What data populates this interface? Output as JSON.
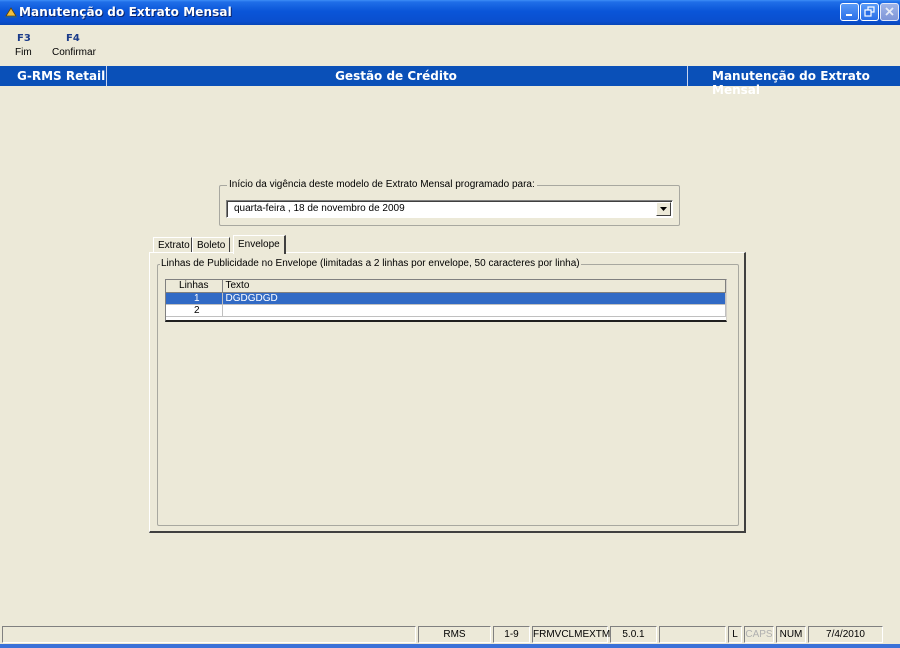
{
  "window": {
    "title": "Manutenção do Extrato Mensal"
  },
  "function_keys": [
    {
      "key": "F3",
      "label": "Fim"
    },
    {
      "key": "F4",
      "label": "Confirmar"
    }
  ],
  "header": {
    "left": "G-RMS Retail",
    "center": "Gestão de Crédito",
    "right": "Manutenção do Extrato Mensal"
  },
  "period": {
    "legend": "Início da vigência deste modelo de Extrato Mensal programado para:",
    "selected": "quarta-feira  , 18 de novembro de 2009"
  },
  "tabs": [
    "Extrato",
    "Boleto",
    "Envelope"
  ],
  "active_tab": "Envelope",
  "envelope": {
    "legend": "Linhas de Publicidade no Envelope (limitadas a 2 linhas por envelope, 50 caracteres por linha)",
    "columns": [
      "Linhas",
      "Texto"
    ],
    "rows": [
      {
        "line": "1",
        "text": "DGDGDGD",
        "selected": true
      },
      {
        "line": "2",
        "text": "",
        "selected": false
      }
    ]
  },
  "status": {
    "system": "RMS",
    "range": "1-9",
    "form": "FRMVCLMEXTM",
    "version": "5.0.1",
    "l": "L",
    "caps": "CAPS",
    "num": "NUM",
    "date": "7/4/2010"
  },
  "colors": {
    "header_band": "#0a50b8",
    "selection": "#316ac5",
    "background": "#ece9d8"
  }
}
